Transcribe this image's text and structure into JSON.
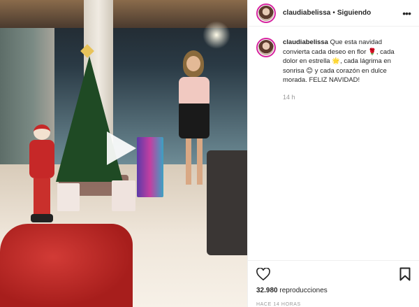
{
  "header": {
    "username": "claudiabelissa",
    "separator": "•",
    "follow_status": "Siguiendo",
    "more_icon": "more-horizontal-icon",
    "more_label": "•••"
  },
  "caption": {
    "username": "claudiabelissa",
    "text": "Que esta navidad convierta cada deseo en flor 🌹, cada dolor en estrella 🌟, cada lágrima en sonrisa 😊 y cada corazón en dulce morada. FELIZ NAVIDAD!",
    "time": "14 h"
  },
  "actions": {
    "like_icon": "heart-icon",
    "save_icon": "bookmark-icon"
  },
  "stats": {
    "views_number": "32.980",
    "views_label": "reproducciones",
    "posted_time": "HACE 14 HORAS"
  },
  "media": {
    "play_icon": "play-icon"
  },
  "colors": {
    "story_ring": "#d6249f",
    "text": "#262626",
    "muted": "#999999",
    "divider": "#efefef"
  }
}
